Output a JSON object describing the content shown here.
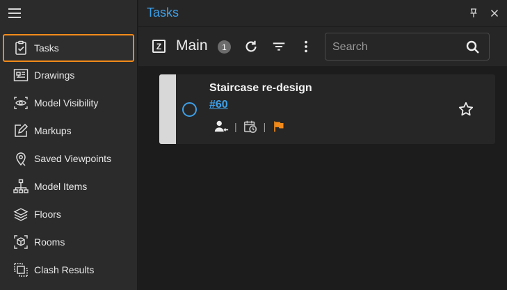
{
  "sidebar": {
    "items": [
      {
        "label": "Tasks",
        "icon": "clipboard-check-icon",
        "active": true
      },
      {
        "label": "Drawings",
        "icon": "drawing-sheet-icon"
      },
      {
        "label": "Model Visibility",
        "icon": "eye-frame-icon"
      },
      {
        "label": "Markups",
        "icon": "pencil-square-icon"
      },
      {
        "label": "Saved Viewpoints",
        "icon": "map-pin-icon"
      },
      {
        "label": "Model Items",
        "icon": "hierarchy-tree-icon"
      },
      {
        "label": "Floors",
        "icon": "layers-icon"
      },
      {
        "label": "Rooms",
        "icon": "cube-frame-icon"
      },
      {
        "label": "Clash Results",
        "icon": "overlap-squares-icon"
      }
    ]
  },
  "panel": {
    "title": "Tasks",
    "toolbar": {
      "tile_letter": "Z",
      "list_name": "Main",
      "count": "1",
      "search_placeholder": "Search"
    },
    "task": {
      "title": "Staircase re-design",
      "id": "#60",
      "flag_color": "#f28a1a",
      "status_color": "#3ea0e8"
    }
  },
  "colors": {
    "accent_blue": "#3ea0e8",
    "active_outline": "#f28a1a"
  }
}
